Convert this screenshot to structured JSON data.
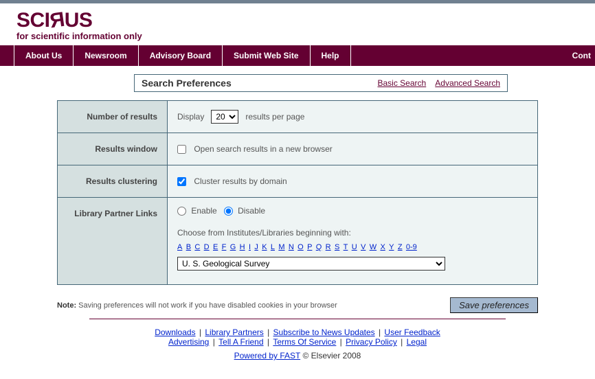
{
  "brand": {
    "name": "SCIRUS",
    "tagline": "for scientific information only"
  },
  "nav": {
    "items": [
      "About Us",
      "Newsroom",
      "Advisory Board",
      "Submit Web Site",
      "Help"
    ],
    "right": "Cont"
  },
  "title_bar": {
    "heading": "Search Preferences",
    "basic": "Basic Search",
    "advanced": "Advanced Search"
  },
  "prefs": {
    "num_results": {
      "label": "Number of results",
      "before": "Display",
      "value": "20",
      "after": "results per page"
    },
    "results_window": {
      "label": "Results window",
      "text": "Open search results in a new browser",
      "checked": false
    },
    "clustering": {
      "label": "Results clustering",
      "text": "Cluster results by domain",
      "checked": true
    },
    "library": {
      "label": "Library Partner Links",
      "enable": "Enable",
      "disable": "Disable",
      "selected": "disable",
      "choose_text": "Choose from Institutes/Libraries beginning with:",
      "alpha": [
        "A",
        "B",
        "C",
        "D",
        "E",
        "F",
        "G",
        "H",
        "I",
        "J",
        "K",
        "L",
        "M",
        "N",
        "O",
        "P",
        "Q",
        "R",
        "S",
        "T",
        "U",
        "V",
        "W",
        "X",
        "Y",
        "Z",
        "0-9"
      ],
      "dropdown": "U. S. Geological Survey"
    }
  },
  "note": {
    "bold": "Note:",
    "text": " Saving preferences will not work if you have disabled cookies in your browser"
  },
  "save_button": "Save preferences",
  "footer": {
    "links1": [
      "Downloads",
      "Library Partners",
      "Subscribe to News Updates",
      "User Feedback"
    ],
    "links2": [
      "Advertising",
      "Tell A Friend",
      "Terms Of Service",
      "Privacy Policy",
      "Legal"
    ],
    "powered": "Powered by FAST",
    "copyright": "© Elsevier 2008"
  }
}
